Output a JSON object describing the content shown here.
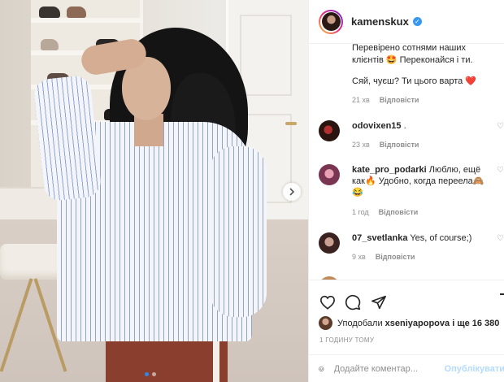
{
  "post": {
    "username": "kamenskux",
    "verified_icon": "verified-check-icon",
    "next_icon": "chevron-right-icon",
    "carousel": {
      "count": 2,
      "active": 0
    }
  },
  "caption": {
    "line1": "Перевірено сотнями наших клієнтів 🤩 Переконайся і ти.",
    "line2": "Сяй, чуєш? Ти цього варта ❤️",
    "time": "21 хв",
    "reply": "Відповісти"
  },
  "comments": [
    {
      "user": "odovixen15",
      "text": ".",
      "time": "23 хв",
      "reply": "Відповісти"
    },
    {
      "user": "kate_pro_podarki",
      "text": "Люблю, ещё как🔥 Удобно, когда переела🙈😂",
      "time": "1 год",
      "reply": "Відповісти"
    },
    {
      "user": "07_svetlanka",
      "text": "Yes, of course;)",
      "time": "9 хв",
      "reply": "Відповісти"
    },
    {
      "user": "",
      "text": "",
      "time": "",
      "reply": ""
    }
  ],
  "actions": {
    "like_icon": "heart-icon",
    "comment_icon": "comment-bubble-icon",
    "share_icon": "paper-plane-icon",
    "save_icon": "bookmark-icon"
  },
  "likes": {
    "prefix": "Уподобали",
    "user": "xseniyapopova",
    "suffix": "і ще 16 380"
  },
  "posted_time": "1 ГОДИНУ ТОМУ",
  "add_comment": {
    "placeholder": "Додайте коментар...",
    "post_label": "Опублікувати",
    "emoji_icon": "smiley-icon"
  },
  "colors": {
    "accent_blue": "#3897f0",
    "post_disabled": "#b3dbff",
    "muted_text": "#8e8e8e",
    "heart_red": "#ed4956"
  }
}
